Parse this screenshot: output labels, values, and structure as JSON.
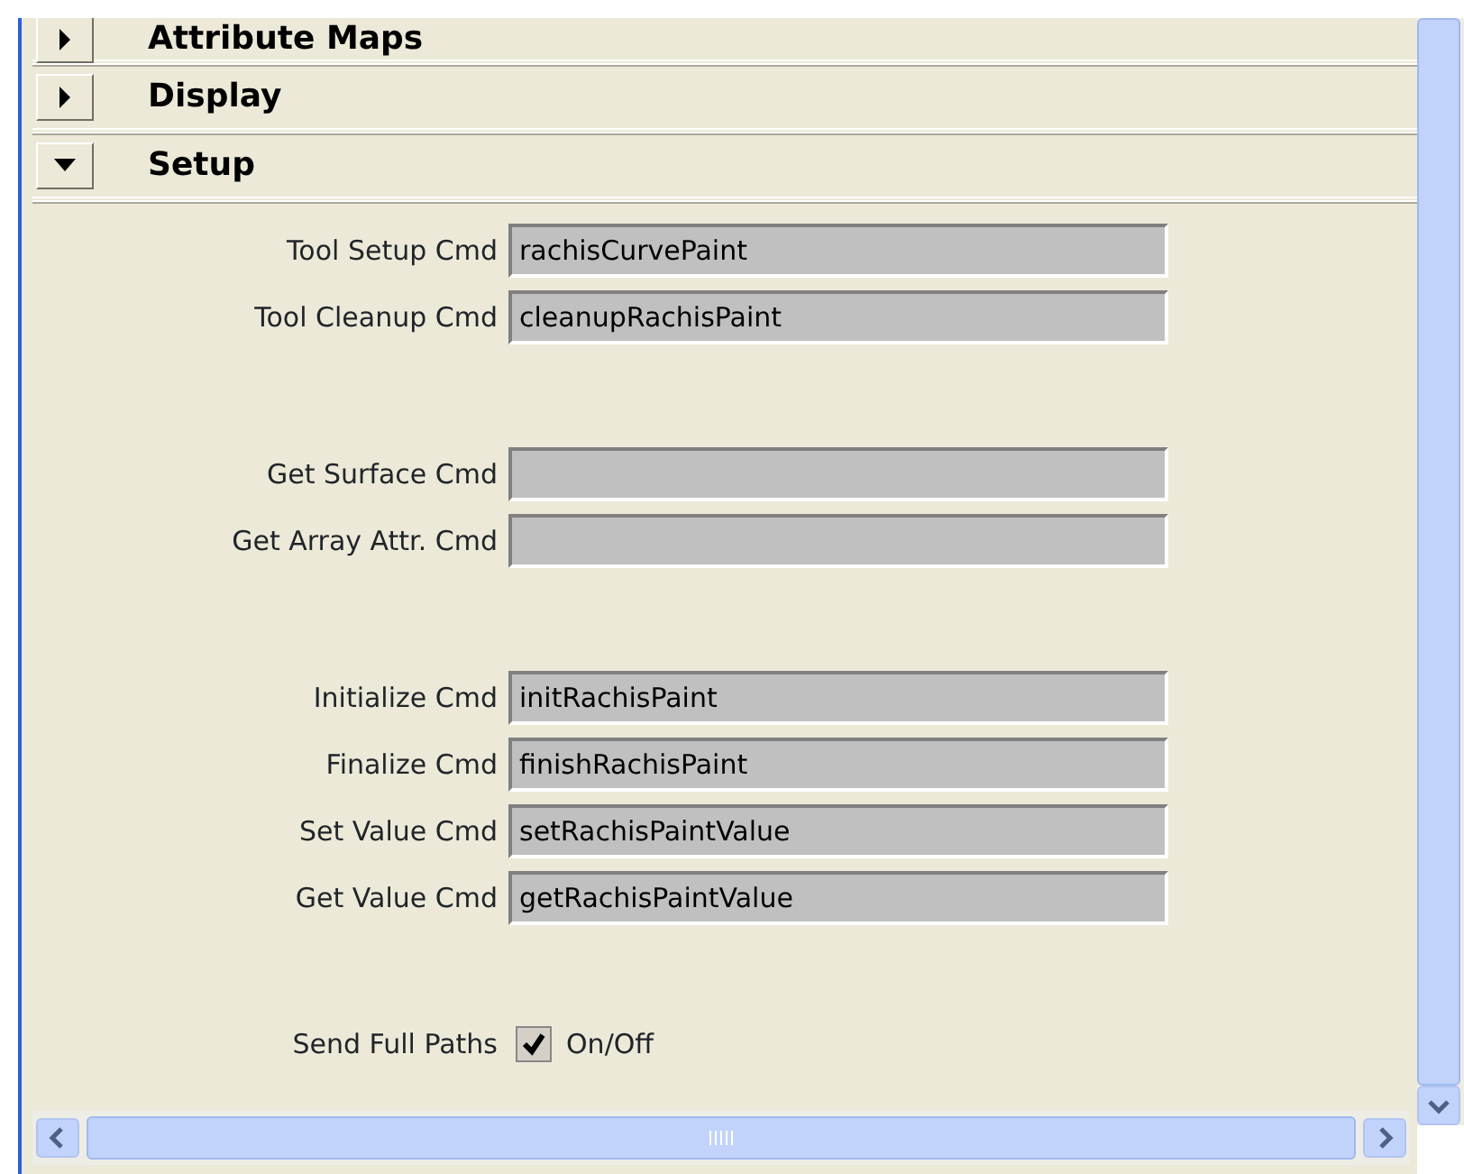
{
  "sections": [
    {
      "title": "Attribute Maps",
      "expanded": false
    },
    {
      "title": "Display",
      "expanded": false
    },
    {
      "title": "Setup",
      "expanded": true
    }
  ],
  "setup": {
    "groups": [
      [
        {
          "label": "Tool Setup Cmd",
          "value": "rachisCurvePaint"
        },
        {
          "label": "Tool Cleanup Cmd",
          "value": "cleanupRachisPaint"
        }
      ],
      [
        {
          "label": "Get Surface Cmd"
        },
        {
          "label": "Get Array Attr. Cmd"
        }
      ],
      [
        {
          "label": "Initialize Cmd",
          "value": "initRachisPaint"
        },
        {
          "label": "Finalize Cmd",
          "value": "finishRachisPaint"
        },
        {
          "label": "Set Value Cmd",
          "value": "setRachisPaintValue"
        },
        {
          "label": "Get Value Cmd",
          "value": "getRachisPaintValue"
        }
      ]
    ],
    "checkbox": {
      "label": "Send Full Paths",
      "text": "On/Off",
      "checked": true
    }
  }
}
